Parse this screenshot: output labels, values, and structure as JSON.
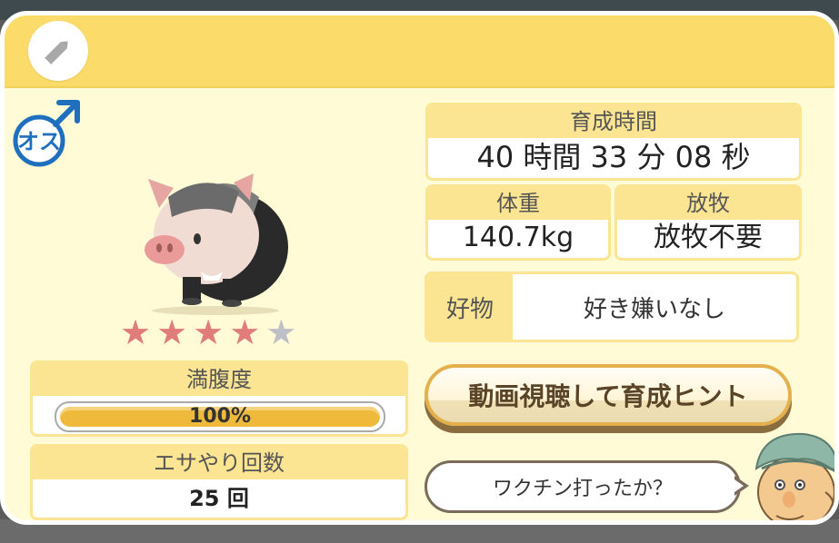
{
  "header": {
    "edit_icon": "pencil-icon"
  },
  "gender": {
    "label": "オス",
    "color": "#1f6fbf"
  },
  "rating": {
    "value": 4,
    "max": 5
  },
  "satiety": {
    "label": "満腹度",
    "value_text": "100%",
    "percent": 100
  },
  "feed_count": {
    "label": "エサやり回数",
    "value": "25 回"
  },
  "raising_time": {
    "label": "育成時間",
    "value": "40 時間 33 分 08 秒"
  },
  "weight": {
    "label": "体重",
    "value": "140.7kg"
  },
  "grazing": {
    "label": "放牧",
    "value": "放牧不要"
  },
  "favorite": {
    "label": "好物",
    "value": "好き嫌いなし"
  },
  "hint_button": {
    "label": "動画視聴して育成ヒント"
  },
  "speech": {
    "text": "ワクチン打ったか？"
  },
  "colors": {
    "header": "#fbdc6b",
    "panel": "#fffbd6",
    "label_bg": "#fbe492",
    "star_on": "#e07c7a",
    "star_off": "#bfbfc7",
    "bar": "#efb93c"
  }
}
